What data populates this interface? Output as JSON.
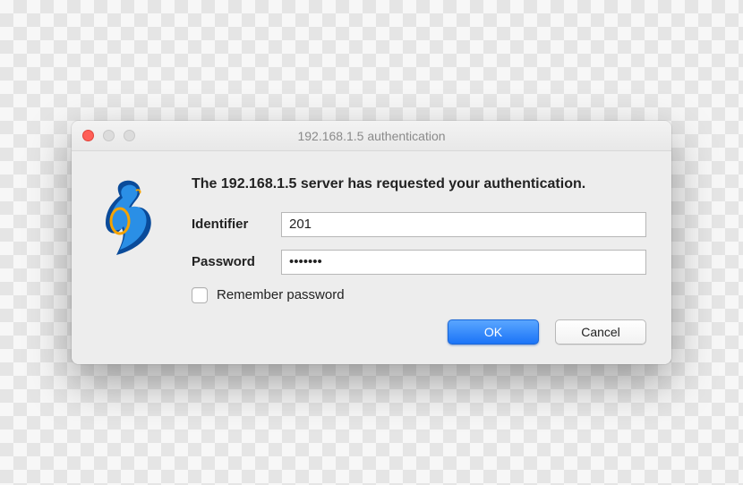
{
  "window": {
    "title": "192.168.1.5 authentication"
  },
  "dialog": {
    "message": "The 192.168.1.5 server has requested your authentication.",
    "identifier_label": "Identifier",
    "identifier_value": "201",
    "password_label": "Password",
    "password_value": "•••••••",
    "remember_label": "Remember password",
    "ok_label": "OK",
    "cancel_label": "Cancel"
  }
}
